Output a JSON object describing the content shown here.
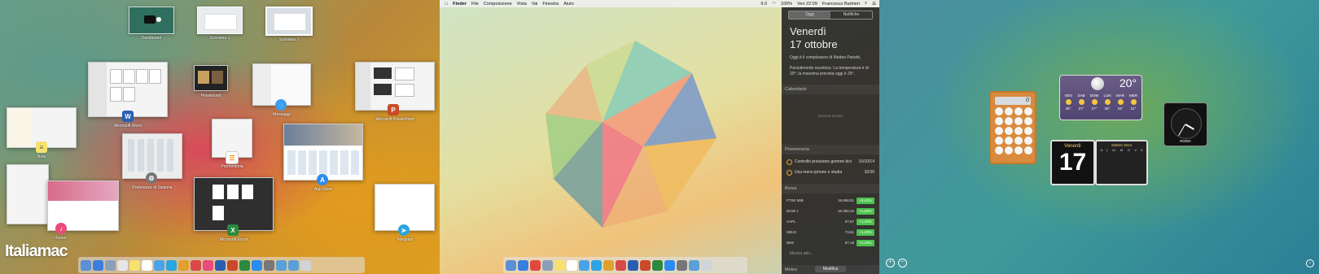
{
  "mission_control": {
    "spaces": [
      {
        "label": "Dashboard"
      },
      {
        "label": "Scrivania 1"
      },
      {
        "label": "Scrivania 2"
      }
    ],
    "windows": {
      "word": "Microsoft Word",
      "preview": "Provvisorio",
      "messages": "Messaggi",
      "powerpoint": "Microsoft PowerPoint",
      "notes": "Note",
      "preferences": "Preferenze di Sistema",
      "reminders": "Promemoria",
      "appstore": "App Store",
      "itunes": "iTunes",
      "excel": "Microsoft Excel",
      "telegram": "Telegram"
    },
    "watermark": "Italiamac"
  },
  "menubar": {
    "items": [
      "Finder",
      "File",
      "Composizione",
      "Vista",
      "Vai",
      "Finestra",
      "Aiuto"
    ],
    "status": [
      "6.0",
      "100%",
      "Ven 22:09",
      "Francesco Barbieri"
    ]
  },
  "notification_center": {
    "tabs": [
      "Oggi",
      "Notifiche"
    ],
    "weekday": "Venerdì",
    "date": "17 ottobre",
    "birthday": "Oggi è il compleanno di Matteo Parietti.",
    "weather_note": "Parzialmente nuvoloso. La temperatura è di 20°; la massima prevista oggi è 25°.",
    "calendar_title": "Calendario",
    "calendar_empty": "Nessun evento",
    "reminders_title": "Promemoria",
    "reminders": [
      {
        "text": "Controllo pressione gomme bici",
        "time": "10/10/14"
      },
      {
        "text": "Usa meno iphone e studia",
        "time": "18:00"
      }
    ],
    "stocks_title": "Borsa",
    "stocks": [
      {
        "name": "FTSE MIB",
        "value": "18.698,91",
        "change": "+3,41%"
      },
      {
        "name": "DOW J",
        "value": "16.380,34",
        "change": "+1,63%"
      },
      {
        "name": "AAPL",
        "value": "97,67",
        "change": "+1,42%"
      },
      {
        "name": "SBUX",
        "value": "73,61",
        "change": "+1,28%"
      },
      {
        "name": "NKE",
        "value": "87,18",
        "change": "+1,18%"
      }
    ],
    "stocks_more": "Mostra altri...",
    "meteo_title": "Meteo",
    "edit_button": "Modifica"
  },
  "dashboard": {
    "calc_display": "0",
    "weather": {
      "temp": "20°",
      "days": [
        {
          "name": "VEN",
          "temp": "25°"
        },
        {
          "name": "SAB",
          "temp": "27°"
        },
        {
          "name": "DOM",
          "temp": "27°"
        },
        {
          "name": "LUN",
          "temp": "25°"
        },
        {
          "name": "MAR",
          "temp": "24°"
        },
        {
          "name": "MER",
          "temp": "21°"
        }
      ]
    },
    "flip_weekday": "Venerdì",
    "flip_day": "17",
    "minical_header": "ottobre 2014",
    "minical_days": [
      "D",
      "L",
      "M",
      "M",
      "G",
      "V",
      "S"
    ],
    "clock_label": "ROMA",
    "add_symbol": "+",
    "remove_symbol": "−",
    "arrow_symbol": "›"
  }
}
